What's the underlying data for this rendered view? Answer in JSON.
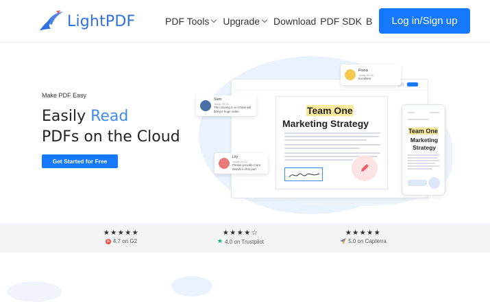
{
  "header": {
    "logo_text": "LightPDF",
    "nav": [
      {
        "label": "PDF Tools",
        "has_dropdown": true
      },
      {
        "label": "Upgrade",
        "has_dropdown": true
      },
      {
        "label": "Download",
        "has_dropdown": false
      },
      {
        "label": "PDF SDK",
        "has_dropdown": false
      },
      {
        "label": "B",
        "has_dropdown": false
      }
    ],
    "login_label": "Log in/Sign up"
  },
  "hero": {
    "tagline": "Make PDF Easy",
    "title_line1_prefix": "Easily ",
    "title_line1_accent": "Read",
    "title_line2": "PDFs on the Cloud",
    "cta_label": "Get Started for Free"
  },
  "illustration": {
    "doc_title_1": "Team One",
    "doc_title_2": "Marketing Strategy",
    "phone_title_1": "Team One",
    "phone_title_2": "Marketing Strategy",
    "comments": [
      {
        "name": "Sam",
        "sub": "Today 10:21",
        "text": "This closing it on I think will bring it huge sales"
      },
      {
        "name": "Fiona",
        "sub": "Today 09:35",
        "text": "Excellent"
      },
      {
        "name": "Lily",
        "sub": "Today 09:12",
        "text": "Please provide more details in this part"
      }
    ]
  },
  "ratings": [
    {
      "stars": "★★★★★",
      "label": "4.7 on G2",
      "icon": "g2-icon"
    },
    {
      "stars": "★★★★☆",
      "label": "4.0 on Trustpilot",
      "icon": "trustpilot-star-icon"
    },
    {
      "stars": "★★★★★",
      "label": "5.0 on Capterra",
      "icon": "capterra-icon"
    }
  ],
  "colors": {
    "accent": "#1677ff",
    "title_accent": "#3d8bf2",
    "highlight": "#fbe99b"
  }
}
